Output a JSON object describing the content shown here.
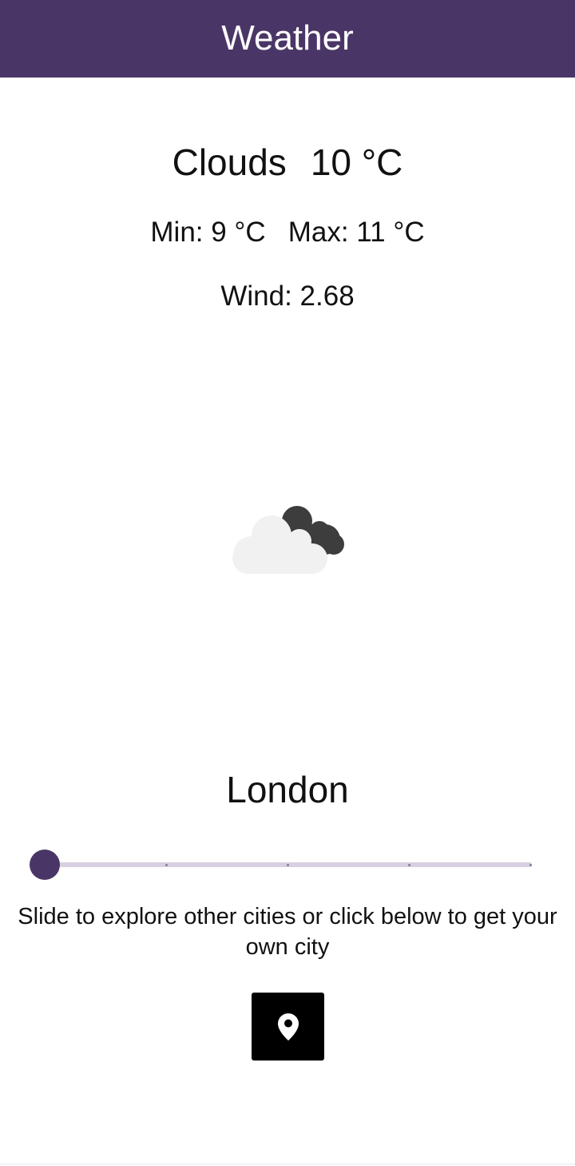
{
  "app_bar": {
    "title": "Weather",
    "color": "#4a3666"
  },
  "weather": {
    "condition": "Clouds",
    "temperature": "10 °C",
    "min": "Min: 9 °C",
    "max": "Max: 11 °C",
    "wind": "Wind: 2.68",
    "icon": "clouds-icon"
  },
  "city": {
    "name": "London"
  },
  "city_slider": {
    "value_index": 0,
    "steps": 5,
    "thumb_color": "#4a3666",
    "track_color": "#d8d0e0"
  },
  "hint_text": "Slide to explore other cities or click below to get your own city",
  "location_button": {
    "icon": "location-pin-icon"
  }
}
